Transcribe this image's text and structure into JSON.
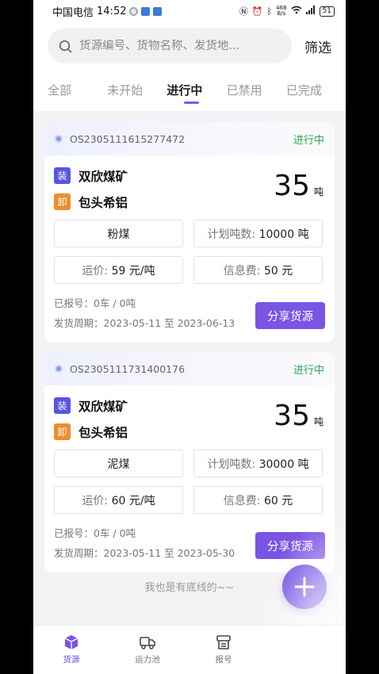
{
  "status_bar": {
    "carrier": "中国电信",
    "time": "14:52",
    "net_speed_top": "468",
    "net_speed_bottom": "B/s",
    "battery": "51"
  },
  "search": {
    "placeholder": "货源编号、货物名称、发货地..."
  },
  "header": {
    "filter_label": "筛选"
  },
  "tabs": [
    {
      "label": "全部"
    },
    {
      "label": "未开始"
    },
    {
      "label": "进行中"
    },
    {
      "label": "已禁用"
    },
    {
      "label": "已完成"
    }
  ],
  "cards": [
    {
      "order_no": "OS2305111615277472",
      "status": "进行中",
      "load_tag": "装",
      "load_place": "双欣煤矿",
      "unload_tag": "卸",
      "unload_place": "包头希铝",
      "tonnage": "35",
      "tonnage_unit": "吨",
      "cargo": "粉煤",
      "plan_label": "计划吨数:",
      "plan_value": "10000 吨",
      "freight_label": "运价:",
      "freight_value": "59 元/吨",
      "info_fee_label": "信息费:",
      "info_fee_value": "50 元",
      "reported": "已报号：0车 / 0吨",
      "period": "发货周期：2023-05-11 至 2023-06-13",
      "share_label": "分享货源"
    },
    {
      "order_no": "OS2305111731400176",
      "status": "进行中",
      "load_tag": "装",
      "load_place": "双欣煤矿",
      "unload_tag": "卸",
      "unload_place": "包头希铝",
      "tonnage": "35",
      "tonnage_unit": "吨",
      "cargo": "泥煤",
      "plan_label": "计划吨数:",
      "plan_value": "30000 吨",
      "freight_label": "运价:",
      "freight_value": "60 元/吨",
      "info_fee_label": "信息费:",
      "info_fee_value": "60 元",
      "reported": "已报号：0车 / 0吨",
      "period": "发货周期：2023-05-11 至 2023-05-30",
      "share_label": "分享货源"
    }
  ],
  "end_text": "我也是有底线的~~",
  "tabbar": [
    {
      "label": "货源",
      "icon": "cube-icon"
    },
    {
      "label": "运力池",
      "icon": "truck-icon"
    },
    {
      "label": "报号",
      "icon": "ticket-icon"
    }
  ],
  "colors": {
    "accent": "#6a48e3",
    "status_green": "#28a855",
    "load_tag": "#5a55e0",
    "unload_tag": "#ec8e2f"
  }
}
